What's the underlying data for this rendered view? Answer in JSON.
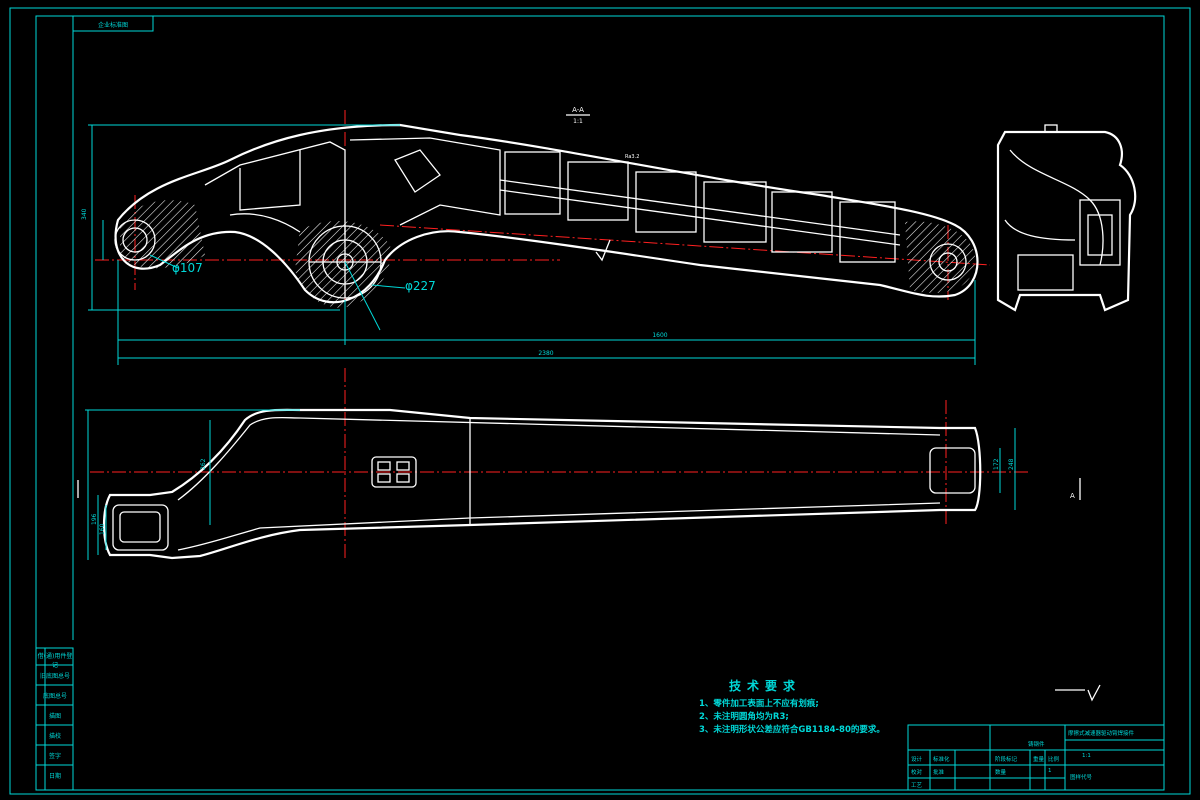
{
  "top_tag": "企业标准图",
  "section_label": "A-A",
  "section_scale": "1:1",
  "view_label": "A",
  "dimensions": {
    "phi_small": "φ107",
    "phi_large": "φ227",
    "total_length": "2380",
    "inner_length": "1600",
    "height_left": "340",
    "side_height": "262",
    "side_right_1": "172",
    "side_right_2": "248",
    "side_left_1": "196",
    "side_left_2": "160",
    "roughness": "Ra3.2"
  },
  "tech_requirements": {
    "title": "技术要求",
    "items": [
      "1、零件加工表面上不应有划痕;",
      "2、未注明圆角均为R3;",
      "3、未注明形状公差应符合GB1184-80的要求。"
    ]
  },
  "side_table": [
    "借(通)用件登记",
    "旧底图总号",
    "底图总号",
    "描图",
    "描校",
    "签字",
    "日期"
  ],
  "title_block": {
    "material": "铸钢件",
    "part_name": "摩擦式减速器驱动臂焊接件",
    "scale_label": "比例",
    "count_label": "数量",
    "sheet": "1:1",
    "drawing_no": "图样代号",
    "designer": "设计",
    "checker": "校对",
    "process": "工艺",
    "standard": "标准化",
    "approve": "批准",
    "weight_label": "重量",
    "stage_label": "阶段标记",
    "qty_value": "1"
  },
  "colors": {
    "frame": "#00d8d8",
    "part": "#ffffff",
    "centerline": "#ff2020",
    "background": "#000000"
  }
}
